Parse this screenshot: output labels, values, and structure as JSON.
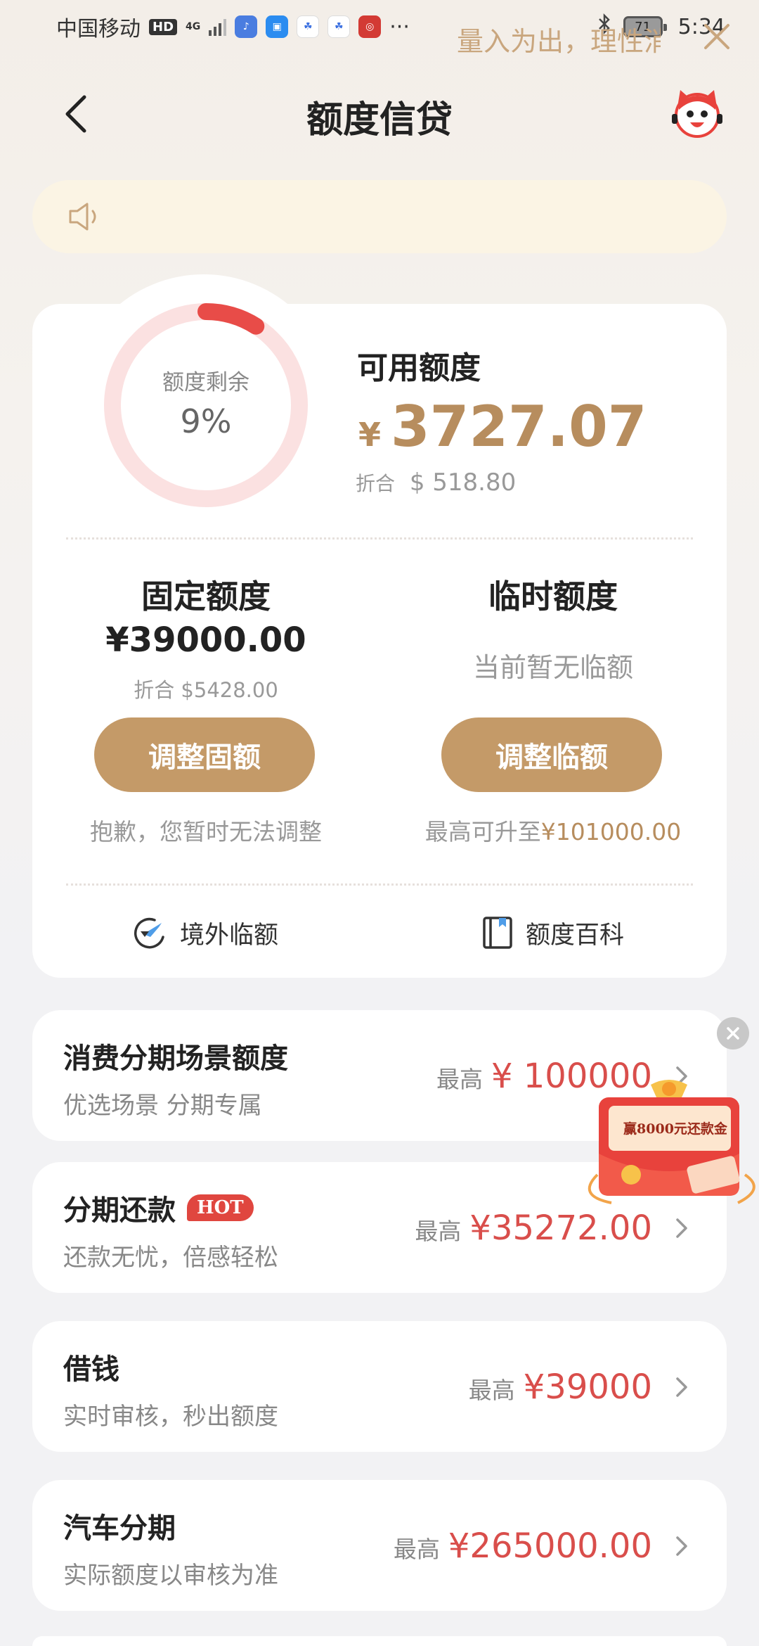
{
  "status_bar": {
    "carrier": "中国移动",
    "hd": "HD",
    "network": "4G",
    "dots": "···",
    "battery": "71",
    "time": "5:34"
  },
  "header": {
    "title": "额度信贷"
  },
  "notice": {
    "text": "量入为出，理性消费"
  },
  "credit": {
    "ring_label": "额度剩余",
    "ring_percent": "9%",
    "ring_fraction": 0.09,
    "available_label": "可用额度",
    "currency_symbol": "¥",
    "available_amount": "3727.07",
    "usd_prefix": "折合",
    "usd_amount": "$ 518.80"
  },
  "fixed_quota": {
    "title": "固定额度",
    "amount": "¥39000.00",
    "usd": "折合 $5428.00",
    "button": "调整固额",
    "note": "抱歉，您暂时无法调整"
  },
  "temp_quota": {
    "title": "临时额度",
    "status": "当前暂无临额",
    "button": "调整临额",
    "note_prefix": "最高可升至",
    "note_amount": "¥101000.00"
  },
  "shortcuts": {
    "overseas": "境外临额",
    "encyclopedia": "额度百科"
  },
  "list": [
    {
      "title": "消费分期场景额度",
      "subtitle": "优选场景 分期专属",
      "prefix": "最高",
      "amount": "¥ 100000"
    },
    {
      "title": "分期还款",
      "badge": "HOT",
      "subtitle": "还款无忧，倍感轻松",
      "prefix": "最高",
      "amount": "¥35272.00"
    },
    {
      "title": "借钱",
      "subtitle": "实时审核，秒出额度",
      "prefix": "最高",
      "amount": "¥39000"
    },
    {
      "title": "汽车分期",
      "subtitle": "实际额度以审核为准",
      "prefix": "最高",
      "amount": "¥265000.00"
    }
  ],
  "promo": {
    "text": "赢8000元还款金"
  },
  "colors": {
    "gold": "#c49a68",
    "gold_text": "#b78d5e",
    "red": "#d94e4b",
    "ring_track": "#fbe1e1",
    "ring_fill": "#e84c48"
  }
}
